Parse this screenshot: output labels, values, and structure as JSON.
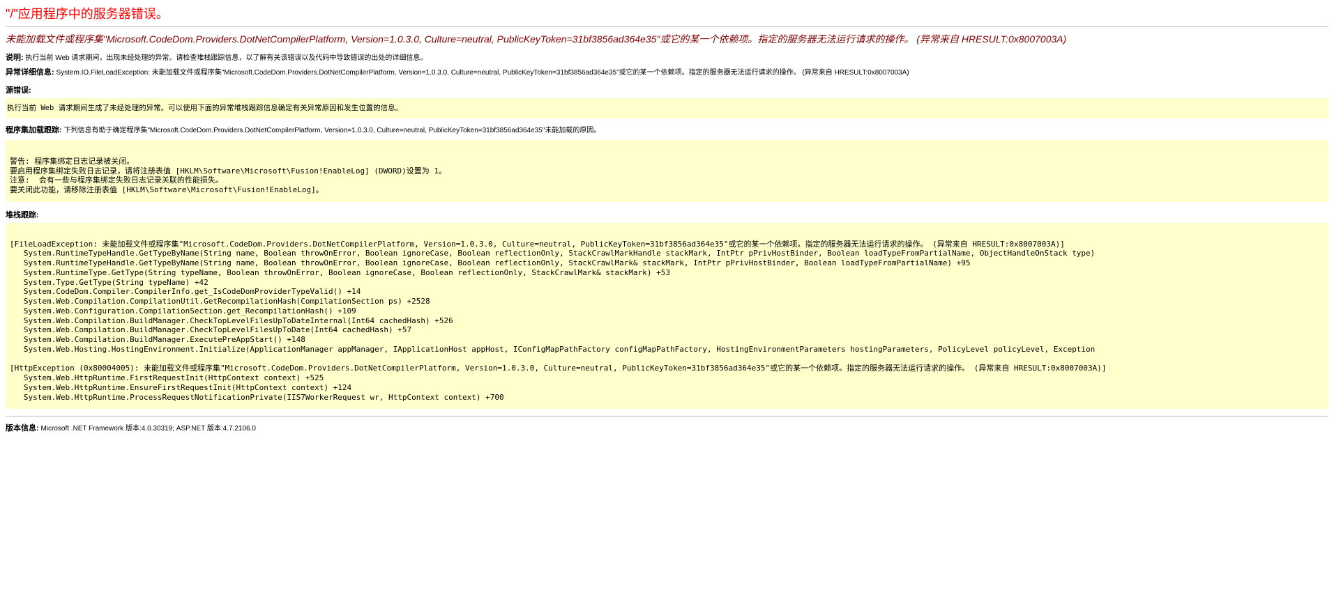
{
  "header": {
    "title": "\"/\"应用程序中的服务器错误。"
  },
  "exception": {
    "message_line1": "未能加载文件或程序集\"Microsoft.CodeDom.Providers.DotNetCompilerPlatform, Version=1.0.3.0, Culture=neutral, PublicKeyToken=31bf3856ad364e35\"或它的某一个依赖项。指定的服务器无法运行请求的操作。 (异常来自 HRESULT:0x8007003A)"
  },
  "desc": {
    "label": "说明:",
    "text": " 执行当前 Web 请求期间，出现未经处理的异常。请检查堆栈跟踪信息，以了解有关该错误以及代码中导致错误的出处的详细信息。"
  },
  "exc_detail": {
    "label": "异常详细信息:",
    "text": " System.IO.FileLoadException: 未能加载文件或程序集\"Microsoft.CodeDom.Providers.DotNetCompilerPlatform, Version=1.0.3.0, Culture=neutral, PublicKeyToken=31bf3856ad364e35\"或它的某一个依赖项。指定的服务器无法运行请求的操作。 (异常来自 HRESULT:0x8007003A)"
  },
  "source_error": {
    "label": "源错误:",
    "code": "执行当前 Web 请求期间生成了未经处理的异常。可以使用下面的异常堆栈跟踪信息确定有关异常原因和发生位置的信息。"
  },
  "asm_load_trace": {
    "label": "程序集加载跟踪:",
    "text": " 下列信息有助于确定程序集\"Microsoft.CodeDom.Providers.DotNetCompilerPlatform, Version=1.0.3.0, Culture=neutral, PublicKeyToken=31bf3856ad364e35\"未能加载的原因。",
    "code": "\n警告: 程序集绑定日志记录被关闭。\n要启用程序集绑定失败日志记录，请将注册表值 [HKLM\\Software\\Microsoft\\Fusion!EnableLog] (DWORD)设置为 1。\n注意:  会有一些与程序集绑定失败日志记录关联的性能损失。\n要关闭此功能，请移除注册表值 [HKLM\\Software\\Microsoft\\Fusion!EnableLog]。\n"
  },
  "stack_trace": {
    "label": "堆栈跟踪:",
    "code": "\n[FileLoadException: 未能加载文件或程序集\"Microsoft.CodeDom.Providers.DotNetCompilerPlatform, Version=1.0.3.0, Culture=neutral, PublicKeyToken=31bf3856ad364e35\"或它的某一个依赖项。指定的服务器无法运行请求的操作。 (异常来自 HRESULT:0x8007003A)]\n   System.RuntimeTypeHandle.GetTypeByName(String name, Boolean throwOnError, Boolean ignoreCase, Boolean reflectionOnly, StackCrawlMarkHandle stackMark, IntPtr pPrivHostBinder, Boolean loadTypeFromPartialName, ObjectHandleOnStack type)\n   System.RuntimeTypeHandle.GetTypeByName(String name, Boolean throwOnError, Boolean ignoreCase, Boolean reflectionOnly, StackCrawlMark& stackMark, IntPtr pPrivHostBinder, Boolean loadTypeFromPartialName) +95\n   System.RuntimeType.GetType(String typeName, Boolean throwOnError, Boolean ignoreCase, Boolean reflectionOnly, StackCrawlMark& stackMark) +53\n   System.Type.GetType(String typeName) +42\n   System.CodeDom.Compiler.CompilerInfo.get_IsCodeDomProviderTypeValid() +14\n   System.Web.Compilation.CompilationUtil.GetRecompilationHash(CompilationSection ps) +2528\n   System.Web.Configuration.CompilationSection.get_RecompilationHash() +109\n   System.Web.Compilation.BuildManager.CheckTopLevelFilesUpToDateInternal(Int64 cachedHash) +526\n   System.Web.Compilation.BuildManager.CheckTopLevelFilesUpToDate(Int64 cachedHash) +57\n   System.Web.Compilation.BuildManager.ExecutePreAppStart() +148\n   System.Web.Hosting.HostingEnvironment.Initialize(ApplicationManager appManager, IApplicationHost appHost, IConfigMapPathFactory configMapPathFactory, HostingEnvironmentParameters hostingParameters, PolicyLevel policyLevel, Exception\n\n[HttpException (0x80004005): 未能加载文件或程序集\"Microsoft.CodeDom.Providers.DotNetCompilerPlatform, Version=1.0.3.0, Culture=neutral, PublicKeyToken=31bf3856ad364e35\"或它的某一个依赖项。指定的服务器无法运行请求的操作。 (异常来自 HRESULT:0x8007003A)]\n   System.Web.HttpRuntime.FirstRequestInit(HttpContext context) +525\n   System.Web.HttpRuntime.EnsureFirstRequestInit(HttpContext context) +124\n   System.Web.HttpRuntime.ProcessRequestNotificationPrivate(IIS7WorkerRequest wr, HttpContext context) +700\n"
  },
  "version": {
    "label": "版本信息:",
    "text": " Microsoft .NET Framework 版本:4.0.30319; ASP.NET 版本:4.7.2106.0"
  }
}
